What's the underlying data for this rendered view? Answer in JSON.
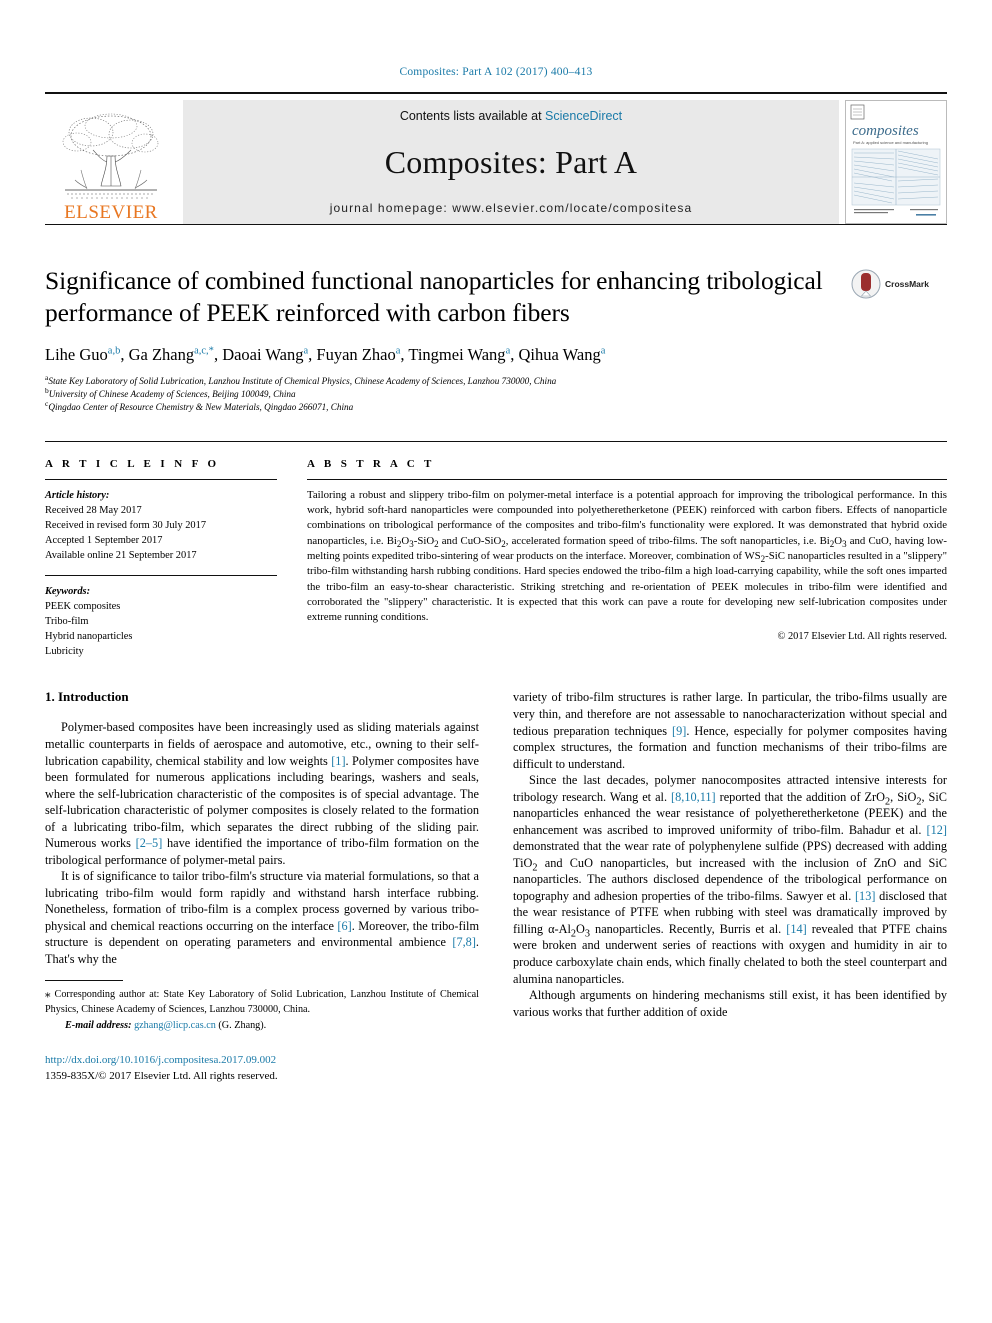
{
  "running_head": "Composites: Part A 102 (2017) 400–413",
  "masthead": {
    "publisher_logo_text": "ELSEVIER",
    "contents_prefix": "Contents lists available at",
    "contents_link": "ScienceDirect",
    "journal_title": "Composites: Part A",
    "homepage_text": "journal homepage: www.elsevier.com/locate/compositesa",
    "cover_title": "composites",
    "cover_subtitle": "Part A: applied science and manufacturing"
  },
  "article": {
    "title": "Significance of combined functional nanoparticles for enhancing tribological performance of PEEK reinforced with carbon fibers",
    "crossmark_label": "CrossMark",
    "authors": [
      {
        "name": "Lihe Guo",
        "sup": "a,b"
      },
      {
        "name": "Ga Zhang",
        "sup": "a,c,*"
      },
      {
        "name": "Daoai Wang",
        "sup": "a"
      },
      {
        "name": "Fuyan Zhao",
        "sup": "a"
      },
      {
        "name": "Tingmei Wang",
        "sup": "a"
      },
      {
        "name": "Qihua Wang",
        "sup": "a"
      }
    ],
    "affiliations": [
      {
        "marker": "a",
        "text": "State Key Laboratory of Solid Lubrication, Lanzhou Institute of Chemical Physics, Chinese Academy of Sciences, Lanzhou 730000, China"
      },
      {
        "marker": "b",
        "text": "University of Chinese Academy of Sciences, Beijing 100049, China"
      },
      {
        "marker": "c",
        "text": "Qingdao Center of Resource Chemistry & New Materials, Qingdao 266071, China"
      }
    ]
  },
  "article_info": {
    "heading": "A R T I C L E   I N F O",
    "history_label": "Article history:",
    "history": [
      "Received 28 May 2017",
      "Received in revised form 30 July 2017",
      "Accepted 1 September 2017",
      "Available online 21 September 2017"
    ],
    "keywords_label": "Keywords:",
    "keywords": [
      "PEEK composites",
      "Tribo-film",
      "Hybrid nanoparticles",
      "Lubricity"
    ]
  },
  "abstract": {
    "heading": "A B S T R A C T",
    "paragraphs": [
      "Tailoring a robust and slippery tribo-film on polymer-metal interface is a potential approach for improving the tribological performance. In this work, hybrid soft-hard nanoparticles were compounded into polyetheretherketone (PEEK) reinforced with carbon fibers. Effects of nanoparticle combinations on tribological performance of the composites and tribo-film's functionality were explored. It was demonstrated that hybrid oxide nanoparticles, i.e. Bi2O3-SiO2 and CuO-SiO2, accelerated formation speed of tribo-films. The soft nanoparticles, i.e. Bi2O3 and CuO, having low-melting points expedited tribo-sintering of wear products on the interface. Moreover, combination of WS2-SiC nanoparticles resulted in a \"slippery\" tribo-film withstanding harsh rubbing conditions. Hard species endowed the tribo-film a high load-carrying capability, while the soft ones imparted the tribo-film an easy-to-shear characteristic. Striking stretching and re-orientation of PEEK molecules in tribo-film were identified and corroborated the \"slippery\" characteristic. It is expected that this work can pave a route for developing new self-lubrication composites under extreme running conditions."
    ],
    "copyright": "© 2017 Elsevier Ltd. All rights reserved."
  },
  "introduction": {
    "heading": "1. Introduction",
    "left_paragraphs": [
      "Polymer-based composites have been increasingly used as sliding materials against metallic counterparts in fields of aerospace and automotive, etc., owning to their self-lubrication capability, chemical stability and low weights [1]. Polymer composites have been formulated for numerous applications including bearings, washers and seals, where the self-lubrication characteristic of the composites is of special advantage. The self-lubrication characteristic of polymer composites is closely related to the formation of a lubricating tribo-film, which separates the direct rubbing of the sliding pair. Numerous works [2–5] have identified the importance of tribo-film formation on the tribological performance of polymer-metal pairs.",
      "It is of significance to tailor tribo-film's structure via material formulations, so that a lubricating tribo-film would form rapidly and withstand harsh interface rubbing. Nonetheless, formation of tribo-film is a complex process governed by various tribo-physical and chemical reactions occurring on the interface [6]. Moreover, the tribo-film structure is dependent on operating parameters and environmental ambience [7,8]. That's why the"
    ],
    "right_paragraphs": [
      "variety of tribo-film structures is rather large. In particular, the tribo-films usually are very thin, and therefore are not assessable to nanocharacterization without special and tedious preparation techniques [9]. Hence, especially for polymer composites having complex structures, the formation and function mechanisms of their tribo-films are difficult to understand.",
      "Since the last decades, polymer nanocomposites attracted intensive interests for tribology research. Wang et al. [8,10,11] reported that the addition of ZrO2, SiO2, SiC nanoparticles enhanced the wear resistance of polyetheretherketone (PEEK) and the enhancement was ascribed to improved uniformity of tribo-film. Bahadur et al. [12] demonstrated that the wear rate of polyphenylene sulfide (PPS) decreased with adding TiO2 and CuO nanoparticles, but increased with the inclusion of ZnO and SiC nanoparticles. The authors disclosed dependence of the tribological performance on topography and adhesion properties of the tribo-films. Sawyer et al. [13] disclosed that the wear resistance of PTFE when rubbing with steel was dramatically improved by filling α-Al2O3 nanoparticles. Recently, Burris et al. [14] revealed that PTFE chains were broken and underwent series of reactions with oxygen and humidity in air to produce carboxylate chain ends, which finally chelated to both the steel counterpart and alumina nanoparticles.",
      "Although arguments on hindering mechanisms still exist, it has been identified by various works that further addition of oxide"
    ]
  },
  "footnote": {
    "marker": "⁎",
    "text": "Corresponding author at: State Key Laboratory of Solid Lubrication, Lanzhou Institute of Chemical Physics, Chinese Academy of Sciences, Lanzhou 730000, China.",
    "email_label": "E-mail address:",
    "email": "gzhang@licp.cas.cn",
    "email_owner": "(G. Zhang)."
  },
  "footer": {
    "doi": "http://dx.doi.org/10.1016/j.compositesa.2017.09.002",
    "issn_line": "1359-835X/© 2017 Elsevier Ltd. All rights reserved."
  },
  "colors": {
    "link_blue": "#1a7aa8",
    "elsevier_orange": "#E87722",
    "band_gray": "#e9e9e9"
  }
}
